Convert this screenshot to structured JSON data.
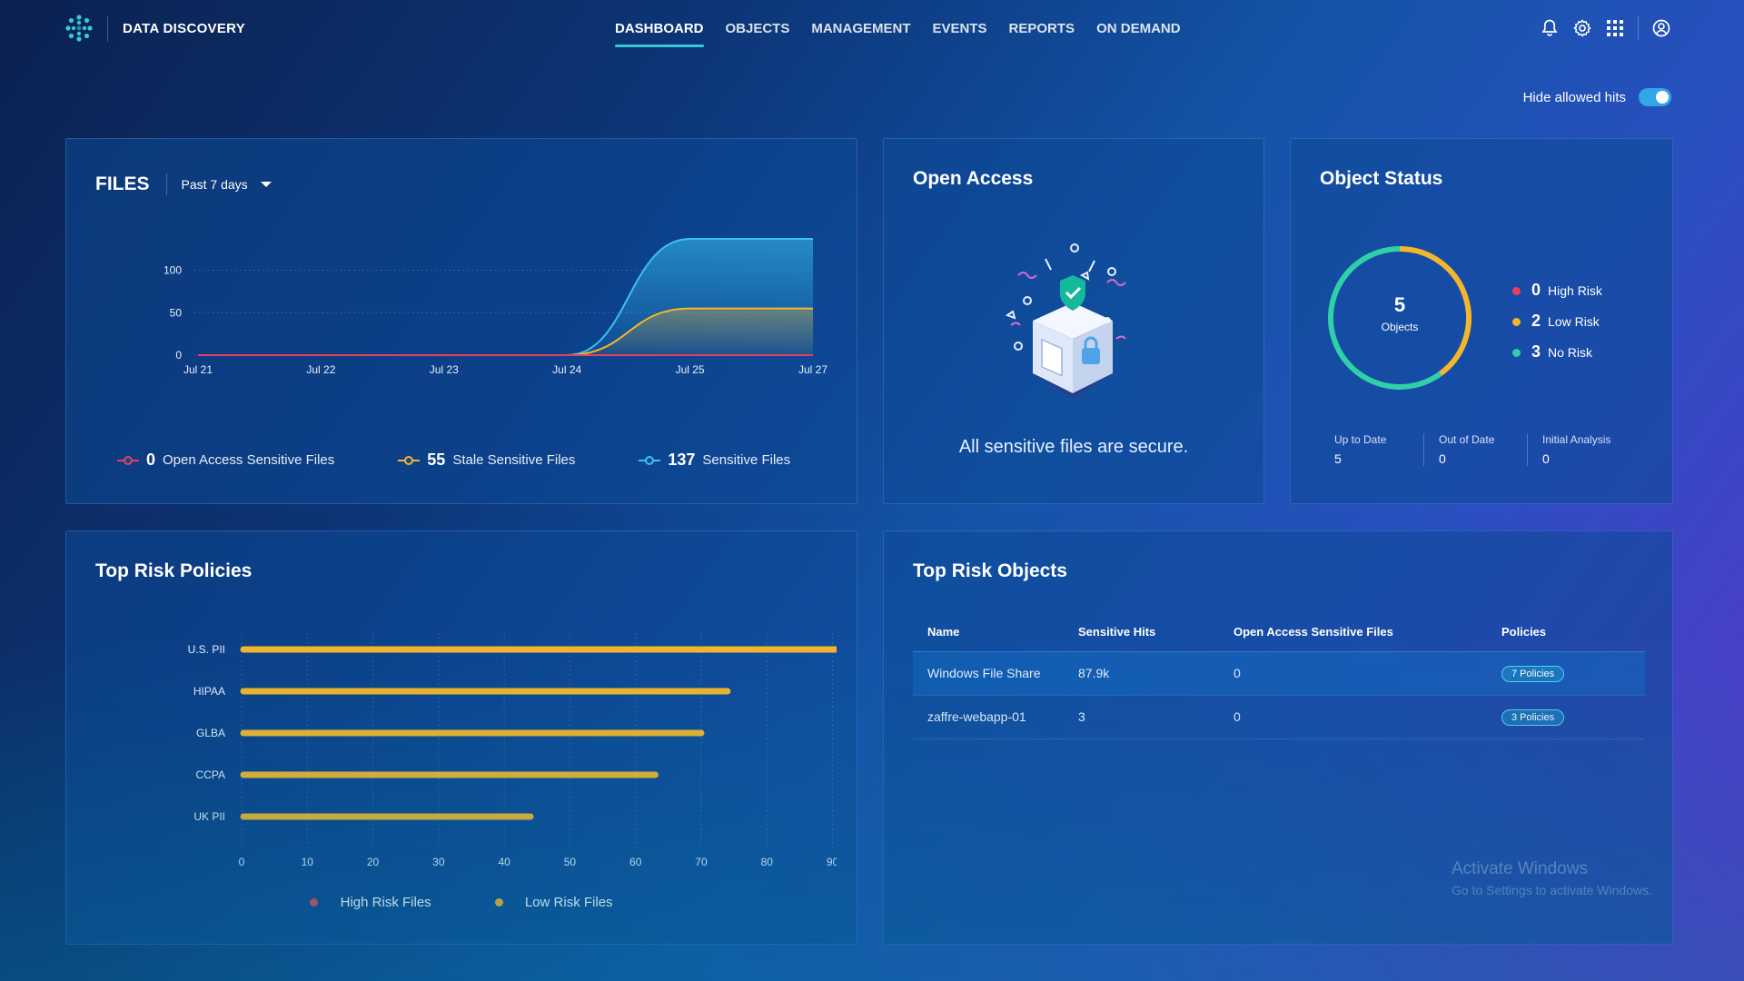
{
  "app": {
    "brand": "DATA DISCOVERY",
    "nav": [
      {
        "label": "DASHBOARD",
        "active": true
      },
      {
        "label": "OBJECTS"
      },
      {
        "label": "MANAGEMENT"
      },
      {
        "label": "EVENTS"
      },
      {
        "label": "REPORTS"
      },
      {
        "label": "ON DEMAND"
      }
    ],
    "icons": [
      "bell-icon",
      "gear-icon",
      "apps-grid-icon",
      "user-account-icon"
    ]
  },
  "controls": {
    "hide_allowed_label": "Hide allowed hits",
    "hide_allowed_on": true
  },
  "files": {
    "title": "FILES",
    "period": "Past 7 days",
    "legend": [
      {
        "value": "0",
        "label": "Open Access Sensitive Files",
        "color": "#e8405a"
      },
      {
        "value": "55",
        "label": "Stale Sensitive Files",
        "color": "#f4b62a"
      },
      {
        "value": "137",
        "label": "Sensitive Files",
        "color": "#38c3f0"
      }
    ]
  },
  "open_access": {
    "title": "Open Access",
    "message": "All sensitive files are secure."
  },
  "object_status": {
    "title": "Object Status",
    "total": "5",
    "total_label": "Objects",
    "risks": [
      {
        "value": "0",
        "label": "High Risk",
        "color": "#e8405a"
      },
      {
        "value": "2",
        "label": "Low Risk",
        "color": "#f4b62a"
      },
      {
        "value": "3",
        "label": "No Risk",
        "color": "#2fd0a8"
      }
    ],
    "stats": [
      {
        "label": "Up to Date",
        "value": "5"
      },
      {
        "label": "Out of Date",
        "value": "0"
      },
      {
        "label": "Initial Analysis",
        "value": "0"
      }
    ]
  },
  "policies": {
    "title": "Top Risk Policies",
    "legend": [
      {
        "label": "High Risk Files",
        "color": "#e8405a"
      },
      {
        "label": "Low Risk Files",
        "color": "#f4b62a"
      }
    ]
  },
  "objects": {
    "title": "Top Risk Objects",
    "columns": [
      "Name",
      "Sensitive Hits",
      "Open Access Sensitive Files",
      "Policies"
    ],
    "rows": [
      {
        "name": "Windows File Share",
        "hits": "87.9k",
        "open": "0",
        "policies": "7 Policies"
      },
      {
        "name": "zaffre-webapp-01",
        "hits": "3",
        "open": "0",
        "policies": "3 Policies"
      }
    ]
  },
  "watermark": {
    "line1": "Activate Windows",
    "line2": "Go to Settings to activate Windows."
  },
  "chart_data": [
    {
      "type": "area",
      "x": [
        "Jul 21",
        "Jul 22",
        "Jul 23",
        "Jul 24",
        "Jul 25",
        "Jul 27"
      ],
      "yticks": [
        0,
        50,
        100
      ],
      "ylim": [
        0,
        137
      ],
      "series": [
        {
          "name": "Open Access Sensitive Files",
          "color": "#e8405a",
          "values": [
            0,
            0,
            0,
            0,
            0,
            0
          ]
        },
        {
          "name": "Stale Sensitive Files",
          "color": "#f4b62a",
          "values": [
            0,
            0,
            0,
            0,
            55,
            55
          ]
        },
        {
          "name": "Sensitive Files",
          "color": "#38c3f0",
          "values": [
            0,
            0,
            0,
            0,
            137,
            137
          ]
        }
      ]
    },
    {
      "type": "bar",
      "orientation": "horizontal",
      "categories": [
        "U.S. PII",
        "HIPAA",
        "GLBA",
        "CCPA",
        "UK PII"
      ],
      "series": [
        {
          "name": "High Risk Files",
          "color": "#e8405a",
          "values": [
            0,
            0,
            0,
            0,
            0
          ]
        },
        {
          "name": "Low Risk Files",
          "color": "#f4b62a",
          "values": [
            92,
            74,
            70,
            63,
            44
          ]
        }
      ],
      "xticks": [
        0,
        10,
        20,
        30,
        40,
        50,
        60,
        70,
        80,
        90
      ],
      "xlim": [
        0,
        92
      ]
    }
  ]
}
